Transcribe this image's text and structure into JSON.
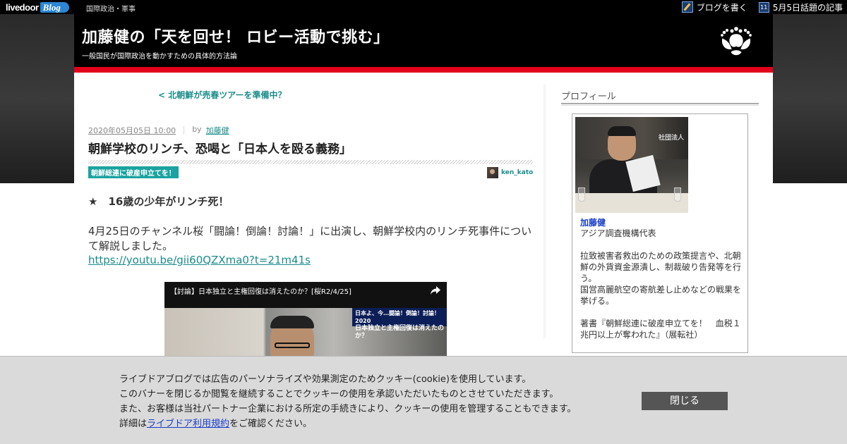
{
  "topbar": {
    "logo_livedoor": "livedoor",
    "logo_blog": "Blog",
    "category": "国際政治・軍事",
    "write_blog": "ブログを書く",
    "calendar_day": "11",
    "trending": "5月5日話題の記事"
  },
  "header": {
    "title": "加藤健の「天を回せ！ ロビー活動で挑む」",
    "description": "一般国民が国際政治を動かすための具体的方法論",
    "crest_icon": "paulownia-crest-icon",
    "accent_color": "#e2001a"
  },
  "article": {
    "prev_link": "< 北朝鮮が売春ツアーを準備中？",
    "date": "2020年05月05日 10:00",
    "separator": "｜",
    "by": "by",
    "author": "加藤健",
    "title": "朝鮮学校のリンチ、恐喝と「日本人を殴る義務」",
    "category": "朝鮮総連に破産申立てを！",
    "author_id": "ken_kato",
    "heading": "★　16歳の少年がリンチ死！",
    "paragraph": "4月25日のチャンネル桜「闘論！倒論！討論！」に出演し、朝鮮学校内のリンチ死事件について解説しました。",
    "url": "https://youtu.be/gii60QZXma0?t=21m41s",
    "video": {
      "title": "【討論】日本独立と主権回復は消えたのか？[桜R2/4/25]",
      "banner_line1": "日本よ、今…闘論！倒論！討論！2020",
      "banner_line2": "日本独立と主権回復は消えたのか？"
    }
  },
  "sidebar": {
    "title": "プロフィール",
    "photo_sign": "社団法人",
    "name": "加藤健",
    "body": "アジア調査機構代表\n\n拉致被害者救出のための政策提言や、北朝鮮の外貨資金源潰し、制裁破り告発等を行う。\n国営高麗航空の寄航差し止めなどの戦果を挙げる。\n\n著書『朝鮮総連に破産申立てを！　血税１兆円以上が奪われた』（展転社）"
  },
  "cookie": {
    "line1": "ライブドアブログでは広告のパーソナライズや効果測定のためクッキー(cookie)を使用しています。",
    "line2": "このバナーを閉じるか閲覧を継続することでクッキーの使用を承認いただいたものとさせていただきます。",
    "line3": "また、お客様は当社パートナー企業における所定の手続きにより、クッキーの使用を管理することもできます。",
    "line4_prefix": "詳細は",
    "line4_link": "ライブドア利用規約",
    "line4_suffix": "をご確認ください。",
    "close": "閉じる"
  }
}
